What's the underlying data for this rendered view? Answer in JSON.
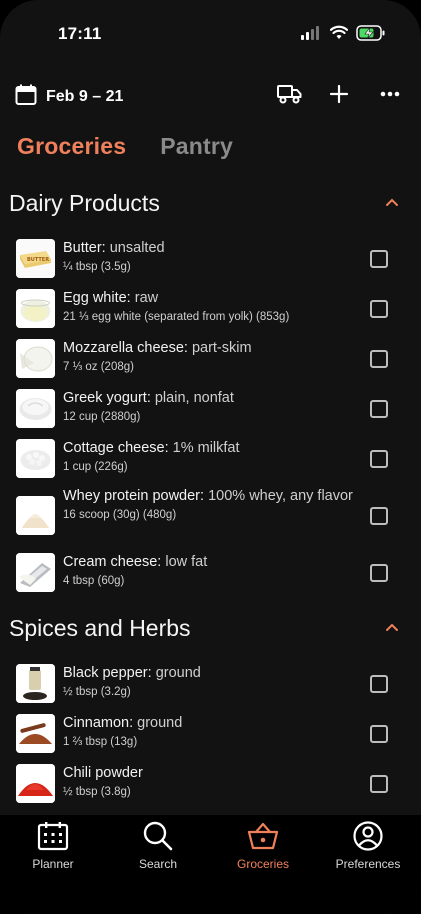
{
  "status_bar": {
    "time": "17:11"
  },
  "header": {
    "date_range": "Feb 9 – 21"
  },
  "tabs": [
    {
      "label": "Groceries",
      "active": true
    },
    {
      "label": "Pantry",
      "active": false
    }
  ],
  "sections": [
    {
      "title": "Dairy Products",
      "items": [
        {
          "name": "Butter:",
          "desc": " unsalted",
          "qty": "¼ tbsp (3.5g)",
          "icon": "butter-icon"
        },
        {
          "name": "Egg white:",
          "desc": " raw",
          "qty": "21 ⅓ egg white (separated from yolk) (853g)",
          "icon": "egg-white-icon"
        },
        {
          "name": "Mozzarella cheese:",
          "desc": " part-skim",
          "qty": "7 ⅓ oz (208g)",
          "icon": "mozzarella-icon"
        },
        {
          "name": "Greek yogurt:",
          "desc": " plain, nonfat",
          "qty": "12 cup (2880g)",
          "icon": "yogurt-icon"
        },
        {
          "name": "Cottage cheese:",
          "desc": " 1% milkfat",
          "qty": "1 cup (226g)",
          "icon": "cottage-cheese-icon"
        },
        {
          "name": "Whey protein powder:",
          "desc": " 100% whey, any flavor",
          "qty": "16 scoop (30g) (480g)",
          "icon": "protein-powder-icon"
        },
        {
          "name": "Cream cheese:",
          "desc": " low fat",
          "qty": "4 tbsp (60g)",
          "icon": "cream-cheese-icon"
        }
      ]
    },
    {
      "title": "Spices and Herbs",
      "items": [
        {
          "name": "Black pepper:",
          "desc": " ground",
          "qty": "½ tbsp (3.2g)",
          "icon": "pepper-icon"
        },
        {
          "name": "Cinnamon:",
          "desc": " ground",
          "qty": "1 ⅔ tbsp (13g)",
          "icon": "cinnamon-icon"
        },
        {
          "name": "Chili powder",
          "desc": "",
          "qty": "½ tbsp (3.8g)",
          "icon": "chili-icon"
        }
      ]
    }
  ],
  "bottom_nav": [
    {
      "label": "Planner",
      "icon": "planner-icon"
    },
    {
      "label": "Search",
      "icon": "search-icon"
    },
    {
      "label": "Groceries",
      "icon": "basket-icon",
      "active": true
    },
    {
      "label": "Preferences",
      "icon": "person-icon"
    }
  ],
  "colors": {
    "accent": "#f0805c",
    "background": "#121212"
  }
}
